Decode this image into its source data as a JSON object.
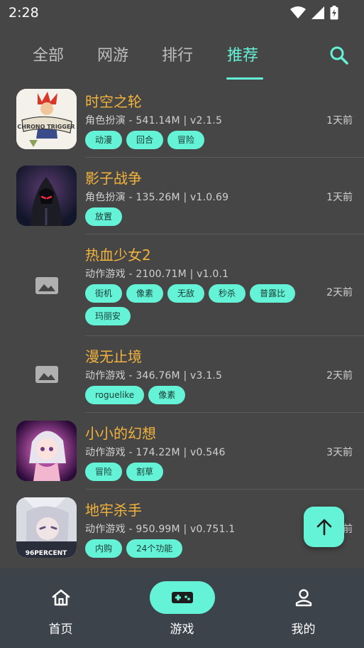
{
  "status": {
    "time": "2:28"
  },
  "tabs": [
    {
      "label": "全部"
    },
    {
      "label": "网游"
    },
    {
      "label": "排行"
    },
    {
      "label": "推荐"
    }
  ],
  "active_tab": "推荐",
  "games": [
    {
      "title": "时空之轮",
      "meta": "角色扮演 - 541.14M | v2.1.5",
      "time": "1天前",
      "tags": [
        "动漫",
        "回合",
        "冒险"
      ]
    },
    {
      "title": "影子战争",
      "meta": "角色扮演 - 135.26M | v1.0.69",
      "time": "1天前",
      "tags": [
        "放置"
      ]
    },
    {
      "title": "热血少女2",
      "meta": "动作游戏 - 2100.71M | v1.0.1",
      "time": "2天前",
      "tags": [
        "街机",
        "像素",
        "无敌",
        "秒杀",
        "普露比",
        "玛丽安"
      ]
    },
    {
      "title": "漫无止境",
      "meta": "动作游戏 - 346.76M | v3.1.5",
      "time": "2天前",
      "tags": [
        "roguelike",
        "像素"
      ]
    },
    {
      "title": "小小的幻想",
      "meta": "动作游戏 - 174.22M | v0.546",
      "time": "3天前",
      "tags": [
        "冒险",
        "割草"
      ]
    },
    {
      "title": "地牢杀手",
      "meta": "动作游戏 - 950.99M | v0.751.1",
      "time": "前",
      "tags": [
        "内购",
        "24个功能"
      ]
    }
  ],
  "thumb_texts": {
    "chrono": "CHRONO TRIGGER",
    "dungeon": "96PERCENT"
  },
  "nav": [
    {
      "label": "首页",
      "icon": "home-icon"
    },
    {
      "label": "游戏",
      "icon": "gamepad-icon"
    },
    {
      "label": "我的",
      "icon": "person-icon"
    }
  ],
  "colors": {
    "background": "#464646",
    "accent": "#64f3d6",
    "title": "#f2b33d",
    "nav_bg": "#3c434b"
  }
}
